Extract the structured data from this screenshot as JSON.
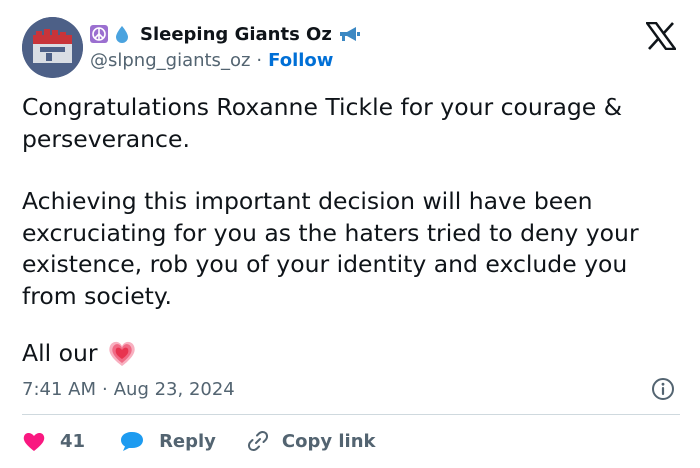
{
  "author": {
    "name": "Sleeping Giants Oz",
    "handle": "@slpng_giants_oz",
    "separator": "·",
    "follow_label": "Follow",
    "badges": [
      "peace-symbol-icon",
      "water-drop-icon"
    ],
    "trailing_badge": "megaphone-icon"
  },
  "tweet": {
    "paragraphs": [
      "Congratulations Roxanne Tickle for your courage & perseverance.",
      "Achieving this important decision will have been excruciating for you as the haters tried to deny your existence, rob you of your identity and exclude you from society."
    ],
    "last_line": "All our",
    "last_line_emoji": "heart-emoji",
    "time": "7:41 AM",
    "separator": "·",
    "date": "Aug 23, 2024"
  },
  "actions": {
    "like_count": "41",
    "reply_label": "Reply",
    "copy_link_label": "Copy link"
  },
  "colors": {
    "like": "#f91880",
    "reply": "#1d9bf0",
    "follow": "#006fd6",
    "muted": "#536471",
    "text": "#0f1419",
    "divider": "#cfd9de"
  }
}
